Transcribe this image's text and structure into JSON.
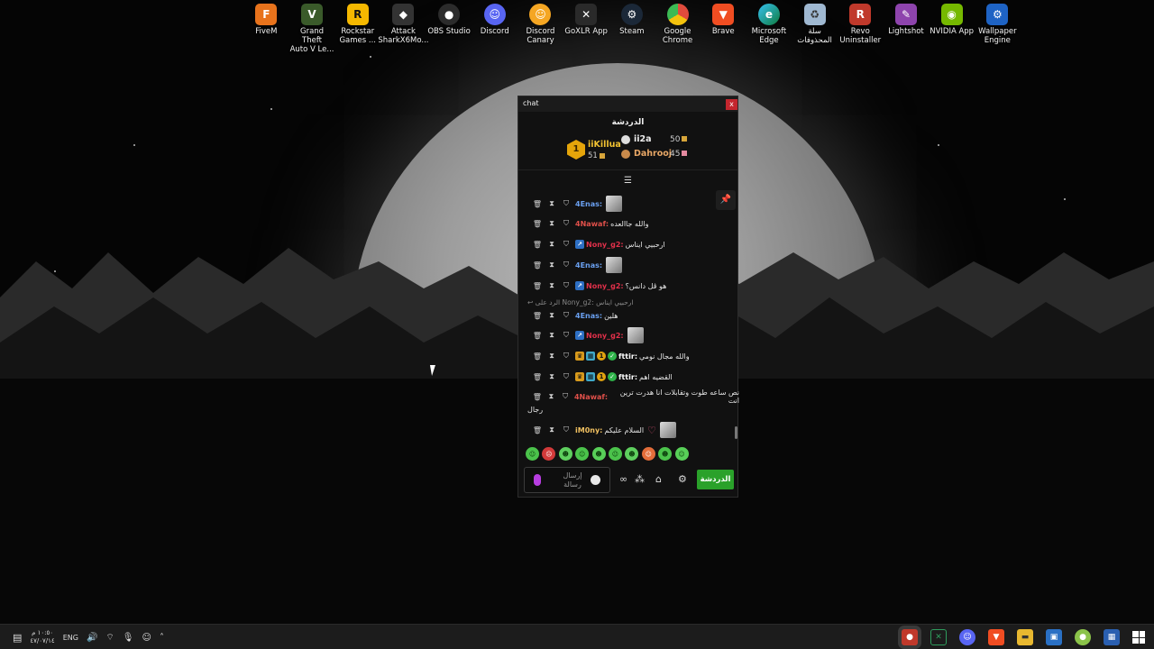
{
  "desktop_icons": [
    {
      "label": "FiveM",
      "icon": "fivem-icon",
      "color": "#e8731c"
    },
    {
      "label": "Grand Theft\nAuto V Le...",
      "icon": "gta-icon",
      "color": "#3a5a2a"
    },
    {
      "label": "Rockstar\nGames ...",
      "icon": "rockstar-icon",
      "color": "#f5b800"
    },
    {
      "label": "Attack\nSharkX6Mo...",
      "icon": "mouse-icon",
      "color": "#333333"
    },
    {
      "label": "OBS Studio",
      "icon": "obs-icon",
      "color": "#2b2b2b"
    },
    {
      "label": "Discord",
      "icon": "discord-icon",
      "color": "#5865f2"
    },
    {
      "label": "Discord\nCanary",
      "icon": "discord-canary-icon",
      "color": "#f5a623"
    },
    {
      "label": "GoXLR App",
      "icon": "goxlr-icon",
      "color": "#2a2a2a"
    },
    {
      "label": "Steam",
      "icon": "steam-icon",
      "color": "#1b2838"
    },
    {
      "label": "Google\nChrome",
      "icon": "chrome-icon",
      "color": "#e04b3c"
    },
    {
      "label": "Brave",
      "icon": "brave-icon",
      "color": "#f04d22"
    },
    {
      "label": "Microsoft\nEdge",
      "icon": "edge-icon",
      "color": "#1aa0c4"
    },
    {
      "label": "سلة\nالمحذوفات",
      "icon": "recycle-bin-icon",
      "color": "#9fb8d1"
    },
    {
      "label": "Revo\nUninstaller",
      "icon": "revo-icon",
      "color": "#c0392b"
    },
    {
      "label": "Lightshot",
      "icon": "lightshot-icon",
      "color": "#8e44ad"
    },
    {
      "label": "NVIDIA App",
      "icon": "nvidia-icon",
      "color": "#76b900"
    },
    {
      "label": "Wallpaper\nEngine",
      "icon": "wallpaper-engine-icon",
      "color": "#1e63c4"
    }
  ],
  "chat": {
    "window_title": "chat",
    "close_label": "x",
    "header": "الدردشة",
    "leader_rank": "1",
    "leader_name": "iiKillua",
    "leader_points": "51",
    "second": {
      "name": "ii2a",
      "points": "50"
    },
    "third": {
      "name": "Dahrooj",
      "points": "45"
    },
    "messages": [
      {
        "name": "4Enas:",
        "text": "",
        "color": "#6aa0f0",
        "avatar": true
      },
      {
        "name": "4Nawaf:",
        "text": "والله جاالعده",
        "color": "#e0504a"
      },
      {
        "name": "Nony_g2:",
        "text": "ارحبيي ايناس",
        "color": "#e0304a"
      },
      {
        "name": "4Enas:",
        "text": "",
        "color": "#6aa0f0",
        "avatar": true
      },
      {
        "name": "Nony_g2:",
        "text": "هو ڤل دانس؟",
        "color": "#e0304a"
      },
      {
        "name": "4Enas:",
        "text": "هلين",
        "color": "#6aa0f0"
      },
      {
        "name": "Nony_g2:",
        "text": "",
        "color": "#e0304a",
        "avatar": true
      },
      {
        "name": "fttir:",
        "text": "والله مجال نومي",
        "color": "#ffffff"
      },
      {
        "name": "fttir:",
        "text": "القضيه اهم",
        "color": "#ffffff"
      },
      {
        "name": "4Nawaf:",
        "text": "نص ساعه طوت وتقابلات انا هدرت ترين انت",
        "color": "#e0504a",
        "wrap": "رجال"
      },
      {
        "name": "iM0ny:",
        "text": "السلام عليكم",
        "color": "#f0c060",
        "avatar": true
      }
    ],
    "reply_text": "الرد على Nony_g2: ارحبيي ايناس",
    "input_placeholder": "إرسال رسالة",
    "send_label": "الدردشة"
  },
  "taskbar": {
    "clock_time": "١٠:٥٠ م",
    "clock_date": "٤٧/٠٧/١٤",
    "language": "ENG"
  }
}
